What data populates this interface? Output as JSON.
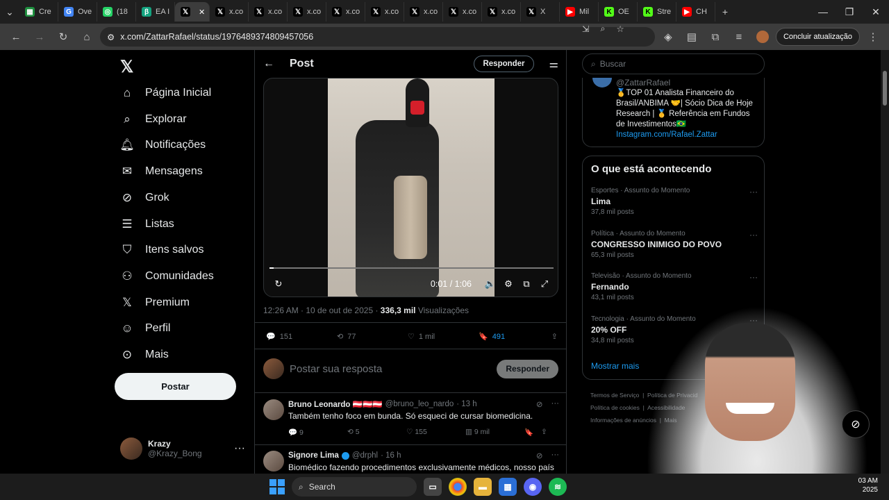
{
  "browser": {
    "tabs": [
      {
        "label": "Cre",
        "icon": "sheets-icon"
      },
      {
        "label": "Ove",
        "icon": "google-icon"
      },
      {
        "label": "(18",
        "icon": "whatsapp-icon"
      },
      {
        "label": "EA I",
        "icon": "app-icon"
      },
      {
        "label": "",
        "icon": "x-icon",
        "active": true
      },
      {
        "label": "x.co",
        "icon": "x-icon"
      },
      {
        "label": "x.co",
        "icon": "x-icon"
      },
      {
        "label": "x.co",
        "icon": "x-icon"
      },
      {
        "label": "x.co",
        "icon": "x-icon"
      },
      {
        "label": "x.co",
        "icon": "x-icon"
      },
      {
        "label": "x.co",
        "icon": "x-icon"
      },
      {
        "label": "x.co",
        "icon": "x-icon"
      },
      {
        "label": "x.co",
        "icon": "x-icon"
      },
      {
        "label": "X",
        "icon": "x-icon"
      },
      {
        "label": "Mil",
        "icon": "youtube-icon"
      },
      {
        "label": "OE",
        "icon": "kick-icon"
      },
      {
        "label": "Stre",
        "icon": "kick-icon"
      },
      {
        "label": "CH",
        "icon": "youtube-icon"
      }
    ],
    "url": "x.com/ZattarRafael/status/1976489374809457056",
    "update_button": "Concluir atualização"
  },
  "nav": {
    "items": [
      {
        "label": "Página Inicial",
        "icon": "home-icon"
      },
      {
        "label": "Explorar",
        "icon": "search-icon"
      },
      {
        "label": "Notificações",
        "icon": "bell-icon"
      },
      {
        "label": "Mensagens",
        "icon": "mail-icon"
      },
      {
        "label": "Grok",
        "icon": "grok-icon"
      },
      {
        "label": "Listas",
        "icon": "list-icon"
      },
      {
        "label": "Itens salvos",
        "icon": "bookmark-icon"
      },
      {
        "label": "Comunidades",
        "icon": "people-icon"
      },
      {
        "label": "Premium",
        "icon": "x-icon"
      },
      {
        "label": "Perfil",
        "icon": "person-icon"
      },
      {
        "label": "Mais",
        "icon": "more-circle-icon"
      }
    ],
    "post_button": "Postar",
    "user": {
      "name": "Krazy",
      "handle": "@Krazy_Bong"
    }
  },
  "post": {
    "header_title": "Post",
    "reply_button": "Responder",
    "video": {
      "time": "0:01 / 1:06",
      "progress": 0.015
    },
    "timestamp": "12:26 AM · 10 de out de 2025 · ",
    "views_count": "336,3 mil",
    "views_label": " Visualizações",
    "stats": {
      "replies": "151",
      "reposts": "77",
      "likes": "1 mil",
      "bookmarks": "491"
    },
    "reply_placeholder": "Postar sua resposta",
    "reply_submit": "Responder"
  },
  "comments": [
    {
      "name": "Bruno Leonardo 🇦🇹🇦🇹🇦🇹",
      "handle": "@bruno_leo_nardo",
      "time": "· 13 h",
      "text": "Também tenho foco em bunda. Só esqueci de cursar biomedicina.",
      "replies": "9",
      "reposts": "5",
      "likes": "155",
      "views": "9 mil"
    },
    {
      "name": "Signore Lima",
      "handle": "@drphl",
      "time": "· 16 h",
      "text": "Biomédico fazendo procedimentos exclusivamente médicos, nosso país é"
    }
  ],
  "sidebar": {
    "search_placeholder": "Buscar",
    "profile": {
      "handle": "@ZattarRafael",
      "bio": "🥇TOP 01 Analista Financeiro do Brasil/ANBIMA 🤝| Sócio Dica de Hoje Research | 🥇 Referência em Fundos de Investimentos🇧🇷",
      "link": "Instagram.com/Rafael.Zattar"
    },
    "trends_title": "O que está acontecendo",
    "trends": [
      {
        "category": "Esportes · Assunto do Momento",
        "name": "Lima",
        "posts": "37,8 mil posts"
      },
      {
        "category": "Política · Assunto do Momento",
        "name": "CONGRESSO INIMIGO DO POVO",
        "posts": "65,3 mil posts"
      },
      {
        "category": "Televisão · Assunto do Momento",
        "name": "Fernando",
        "posts": "43,1 mil posts"
      },
      {
        "category": "Tecnologia · Assunto do Momento",
        "name": "20% OFF",
        "posts": "34,8 mil posts"
      }
    ],
    "show_more": "Mostrar mais",
    "footer": [
      "Termos de Serviço",
      "Política de Privacid",
      "Política de cookies",
      "Acessibilidade",
      "Informações de anúncios",
      "Mais"
    ]
  },
  "taskbar": {
    "search_label": "Search",
    "time": "03 AM",
    "date": "2025"
  }
}
